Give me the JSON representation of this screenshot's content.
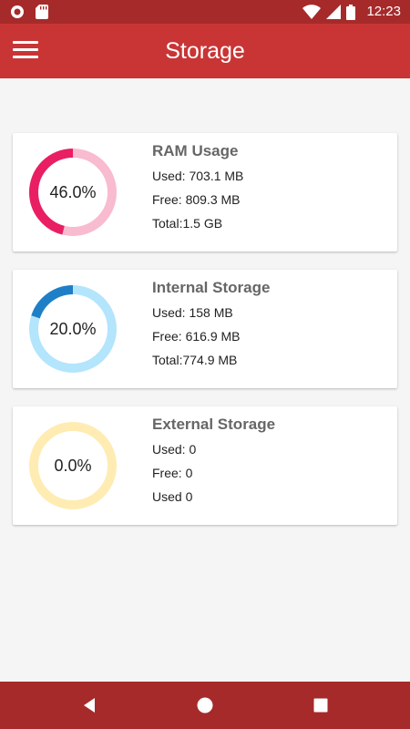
{
  "status_bar": {
    "time": "12:23",
    "icons": [
      "notification-circle-icon",
      "sd-card-icon",
      "wifi-icon",
      "signal-icon",
      "battery-icon"
    ]
  },
  "app_bar": {
    "title": "Storage",
    "menu_icon": "hamburger-menu-icon"
  },
  "cards": [
    {
      "title": "RAM Usage",
      "percent_label": "46.0%",
      "percent": 46.0,
      "used": "Used:  703.1 MB",
      "free": "Free: 809.3 MB",
      "total": "Total:1.5 GB",
      "colors": {
        "track": "#f8bbd0",
        "fill": "#e91e63"
      }
    },
    {
      "title": "Internal Storage",
      "percent_label": "20.0%",
      "percent": 20.0,
      "used": "Used:  158 MB",
      "free": "Free: 616.9 MB",
      "total": "Total:774.9 MB",
      "colors": {
        "track": "#b3e5fc",
        "fill": "#1e7fc7"
      }
    },
    {
      "title": "External Storage",
      "percent_label": "0.0%",
      "percent": 0.0,
      "used": "Used:  0",
      "free": "Free: 0",
      "total": "Used 0",
      "colors": {
        "track": "#ffecb3",
        "fill": "#ffc107"
      }
    }
  ],
  "nav_bar": {
    "icons": [
      "back-icon",
      "home-icon",
      "recents-icon"
    ]
  },
  "theme": {
    "status_bar": "#a62a2a",
    "app_bar": "#c93535",
    "background": "#f5f5f5"
  }
}
